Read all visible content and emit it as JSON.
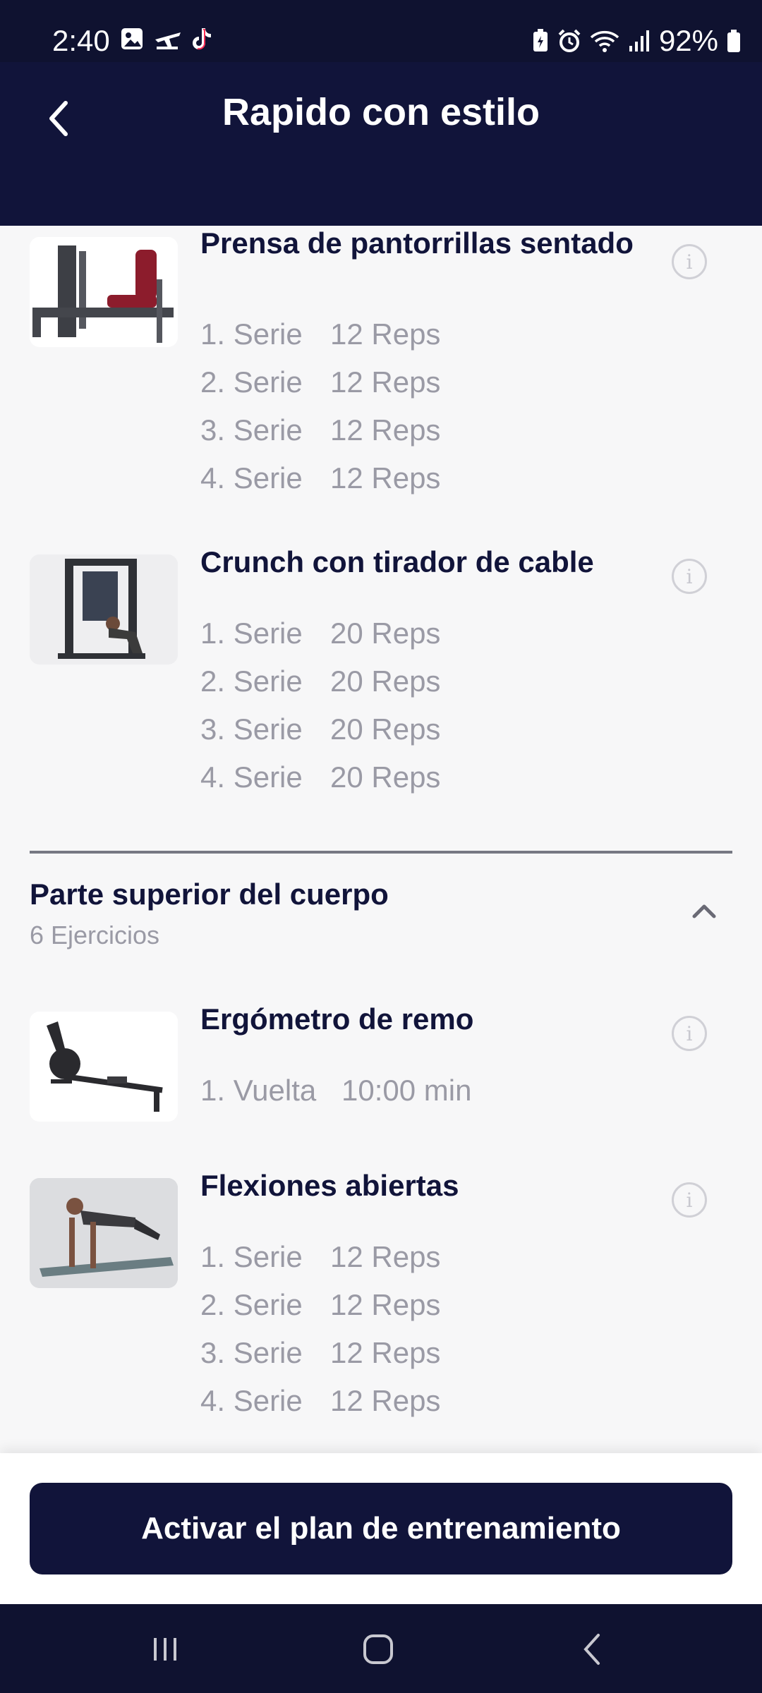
{
  "status_bar": {
    "time": "2:40",
    "battery": "92%",
    "left_icons": [
      "gallery-icon",
      "flight-icon",
      "tiktok-icon"
    ],
    "right_icons": [
      "battery-saver-icon",
      "alarm-icon",
      "wifi-icon",
      "signal-icon",
      "battery-icon"
    ]
  },
  "header": {
    "title": "Rapido con estilo",
    "back_icon": "back-arrow-icon"
  },
  "exercises_group1": [
    {
      "name": "Prensa de pantorrillas sentado",
      "image": "calf-press-machine",
      "sets": [
        {
          "num": "1. Serie",
          "value": "12 Reps"
        },
        {
          "num": "2. Serie",
          "value": "12 Reps"
        },
        {
          "num": "3. Serie",
          "value": "12 Reps"
        },
        {
          "num": "4. Serie",
          "value": "12 Reps"
        }
      ]
    },
    {
      "name": "Crunch con tirador de cable",
      "image": "cable-crunch-machine",
      "sets": [
        {
          "num": "1. Serie",
          "value": "20 Reps"
        },
        {
          "num": "2. Serie",
          "value": "20 Reps"
        },
        {
          "num": "3. Serie",
          "value": "20 Reps"
        },
        {
          "num": "4. Serie",
          "value": "20 Reps"
        }
      ]
    }
  ],
  "section": {
    "title": "Parte superior del cuerpo",
    "subtitle": "6 Ejercicios",
    "expanded": true
  },
  "exercises_group2": [
    {
      "name": "Ergómetro de remo",
      "image": "rowing-ergometer",
      "sets": [
        {
          "num": "1. Vuelta",
          "value": "10:00 min"
        }
      ]
    },
    {
      "name": "Flexiones abiertas",
      "image": "wide-pushup",
      "sets": [
        {
          "num": "1. Serie",
          "value": "12 Reps"
        },
        {
          "num": "2. Serie",
          "value": "12 Reps"
        },
        {
          "num": "3. Serie",
          "value": "12 Reps"
        },
        {
          "num": "4. Serie",
          "value": "12 Reps"
        }
      ]
    }
  ],
  "cta": {
    "label": "Activar el plan de entrenamiento"
  },
  "nav": {
    "recents_icon": "recent-apps-icon",
    "home_icon": "home-icon",
    "back_icon": "back-icon"
  },
  "colors": {
    "primary": "#11143a",
    "muted_text": "#9a9aa5",
    "background": "#f7f7f8"
  }
}
